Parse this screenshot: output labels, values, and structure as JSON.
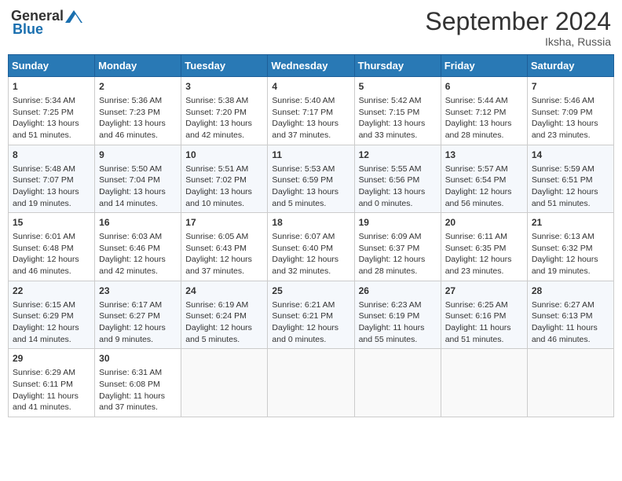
{
  "header": {
    "logo_general": "General",
    "logo_blue": "Blue",
    "month_title": "September 2024",
    "location": "Iksha, Russia"
  },
  "days_of_week": [
    "Sunday",
    "Monday",
    "Tuesday",
    "Wednesday",
    "Thursday",
    "Friday",
    "Saturday"
  ],
  "weeks": [
    [
      {
        "num": "1",
        "sunrise": "5:34 AM",
        "sunset": "7:25 PM",
        "daylight": "13 hours and 51 minutes."
      },
      {
        "num": "2",
        "sunrise": "5:36 AM",
        "sunset": "7:23 PM",
        "daylight": "13 hours and 46 minutes."
      },
      {
        "num": "3",
        "sunrise": "5:38 AM",
        "sunset": "7:20 PM",
        "daylight": "13 hours and 42 minutes."
      },
      {
        "num": "4",
        "sunrise": "5:40 AM",
        "sunset": "7:17 PM",
        "daylight": "13 hours and 37 minutes."
      },
      {
        "num": "5",
        "sunrise": "5:42 AM",
        "sunset": "7:15 PM",
        "daylight": "13 hours and 33 minutes."
      },
      {
        "num": "6",
        "sunrise": "5:44 AM",
        "sunset": "7:12 PM",
        "daylight": "13 hours and 28 minutes."
      },
      {
        "num": "7",
        "sunrise": "5:46 AM",
        "sunset": "7:09 PM",
        "daylight": "13 hours and 23 minutes."
      }
    ],
    [
      {
        "num": "8",
        "sunrise": "5:48 AM",
        "sunset": "7:07 PM",
        "daylight": "13 hours and 19 minutes."
      },
      {
        "num": "9",
        "sunrise": "5:50 AM",
        "sunset": "7:04 PM",
        "daylight": "13 hours and 14 minutes."
      },
      {
        "num": "10",
        "sunrise": "5:51 AM",
        "sunset": "7:02 PM",
        "daylight": "13 hours and 10 minutes."
      },
      {
        "num": "11",
        "sunrise": "5:53 AM",
        "sunset": "6:59 PM",
        "daylight": "13 hours and 5 minutes."
      },
      {
        "num": "12",
        "sunrise": "5:55 AM",
        "sunset": "6:56 PM",
        "daylight": "13 hours and 0 minutes."
      },
      {
        "num": "13",
        "sunrise": "5:57 AM",
        "sunset": "6:54 PM",
        "daylight": "12 hours and 56 minutes."
      },
      {
        "num": "14",
        "sunrise": "5:59 AM",
        "sunset": "6:51 PM",
        "daylight": "12 hours and 51 minutes."
      }
    ],
    [
      {
        "num": "15",
        "sunrise": "6:01 AM",
        "sunset": "6:48 PM",
        "daylight": "12 hours and 46 minutes."
      },
      {
        "num": "16",
        "sunrise": "6:03 AM",
        "sunset": "6:46 PM",
        "daylight": "12 hours and 42 minutes."
      },
      {
        "num": "17",
        "sunrise": "6:05 AM",
        "sunset": "6:43 PM",
        "daylight": "12 hours and 37 minutes."
      },
      {
        "num": "18",
        "sunrise": "6:07 AM",
        "sunset": "6:40 PM",
        "daylight": "12 hours and 32 minutes."
      },
      {
        "num": "19",
        "sunrise": "6:09 AM",
        "sunset": "6:37 PM",
        "daylight": "12 hours and 28 minutes."
      },
      {
        "num": "20",
        "sunrise": "6:11 AM",
        "sunset": "6:35 PM",
        "daylight": "12 hours and 23 minutes."
      },
      {
        "num": "21",
        "sunrise": "6:13 AM",
        "sunset": "6:32 PM",
        "daylight": "12 hours and 19 minutes."
      }
    ],
    [
      {
        "num": "22",
        "sunrise": "6:15 AM",
        "sunset": "6:29 PM",
        "daylight": "12 hours and 14 minutes."
      },
      {
        "num": "23",
        "sunrise": "6:17 AM",
        "sunset": "6:27 PM",
        "daylight": "12 hours and 9 minutes."
      },
      {
        "num": "24",
        "sunrise": "6:19 AM",
        "sunset": "6:24 PM",
        "daylight": "12 hours and 5 minutes."
      },
      {
        "num": "25",
        "sunrise": "6:21 AM",
        "sunset": "6:21 PM",
        "daylight": "12 hours and 0 minutes."
      },
      {
        "num": "26",
        "sunrise": "6:23 AM",
        "sunset": "6:19 PM",
        "daylight": "11 hours and 55 minutes."
      },
      {
        "num": "27",
        "sunrise": "6:25 AM",
        "sunset": "6:16 PM",
        "daylight": "11 hours and 51 minutes."
      },
      {
        "num": "28",
        "sunrise": "6:27 AM",
        "sunset": "6:13 PM",
        "daylight": "11 hours and 46 minutes."
      }
    ],
    [
      {
        "num": "29",
        "sunrise": "6:29 AM",
        "sunset": "6:11 PM",
        "daylight": "11 hours and 41 minutes."
      },
      {
        "num": "30",
        "sunrise": "6:31 AM",
        "sunset": "6:08 PM",
        "daylight": "11 hours and 37 minutes."
      },
      null,
      null,
      null,
      null,
      null
    ]
  ]
}
